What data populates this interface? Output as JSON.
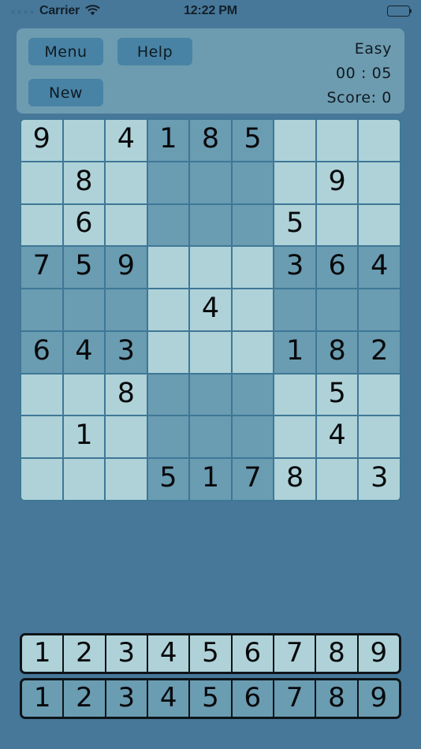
{
  "status_bar": {
    "carrier": "Carrier",
    "time": "12:22 PM",
    "signal_icon": "signal-dots-icon",
    "wifi_icon": "wifi-icon",
    "battery_icon": "battery-full-icon"
  },
  "header": {
    "menu_label": "Menu",
    "help_label": "Help",
    "new_label": "New",
    "difficulty": "Easy",
    "timer": "00 : 05",
    "score": "Score: 0"
  },
  "colors": {
    "page_background": "#47789a",
    "header_panel": "#6d9cb0",
    "button": "#4883a5",
    "cell_light": "#aed2d8",
    "cell_dark": "#6a9cb2",
    "grid_line": "#3f7796",
    "digit": "#07090b",
    "pad_border": "#0e1418"
  },
  "board": {
    "rows": 9,
    "columns": 9,
    "grid": [
      [
        "9",
        "",
        "4",
        "1",
        "8",
        "5",
        "",
        "",
        ""
      ],
      [
        "",
        "8",
        "",
        "",
        "",
        "",
        "",
        "9",
        ""
      ],
      [
        "",
        "6",
        "",
        "",
        "",
        "",
        "5",
        "",
        ""
      ],
      [
        "7",
        "5",
        "9",
        "",
        "",
        "",
        "3",
        "6",
        "4"
      ],
      [
        "",
        "",
        "",
        "",
        "4",
        "",
        "",
        "",
        ""
      ],
      [
        "6",
        "4",
        "3",
        "",
        "",
        "",
        "1",
        "8",
        "2"
      ],
      [
        "",
        "",
        "8",
        "",
        "",
        "",
        "",
        "5",
        ""
      ],
      [
        "",
        "1",
        "",
        "",
        "",
        "",
        "",
        "4",
        ""
      ],
      [
        "",
        "",
        "",
        "5",
        "1",
        "7",
        "8",
        "",
        "3"
      ]
    ]
  },
  "numpad_top": {
    "keys": [
      "1",
      "2",
      "3",
      "4",
      "5",
      "6",
      "7",
      "8",
      "9"
    ]
  },
  "numpad_bottom": {
    "keys": [
      "1",
      "2",
      "3",
      "4",
      "5",
      "6",
      "7",
      "8",
      "9"
    ]
  }
}
